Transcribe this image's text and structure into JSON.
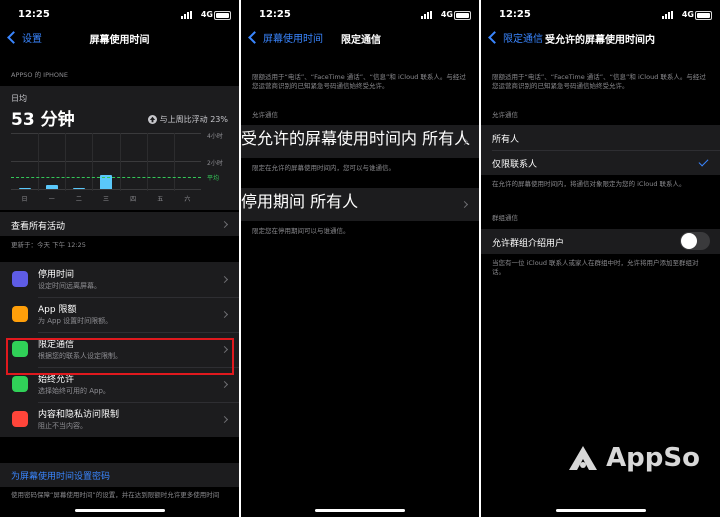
{
  "status": {
    "time": "12:25",
    "network": "4G"
  },
  "s1": {
    "back": "设置",
    "title": "屏幕使用时间",
    "device": "APPSO 的 IPHONE",
    "avg_label": "日均",
    "avg_value": "53 分钟",
    "compare": "与上周比浮动 23%",
    "chart_data": {
      "type": "bar",
      "categories": [
        "日",
        "一",
        "二",
        "三",
        "四",
        "五",
        "六"
      ],
      "values": [
        3,
        18,
        6,
        62,
        0,
        0,
        0
      ],
      "ylabels": [
        "4小时",
        "2小时"
      ],
      "avg_label": "平均",
      "avg_value": 53,
      "ylim": [
        0,
        240
      ]
    },
    "see_all": "查看所有活动",
    "updated": "更新于：今天 下午 12:25",
    "items": [
      {
        "title": "停用时间",
        "sub": "设定时间远离屏幕。",
        "color": "#5e5ce6"
      },
      {
        "title": "App 限额",
        "sub": "为 App 设置时间限额。",
        "color": "#ff9f0a"
      },
      {
        "title": "限定通信",
        "sub": "根据您的联系人设定限制。",
        "color": "#30d158"
      },
      {
        "title": "始终允许",
        "sub": "选择始终可用的 App。",
        "color": "#30d158"
      },
      {
        "title": "内容和隐私访问限制",
        "sub": "阻止不当内容。",
        "color": "#ff453a"
      }
    ],
    "passcode": "为屏幕使用时间设置密码",
    "passcode_note": "使用密码保障“屏幕使用时间”的设置，并在达到限额时允许更多使用时间"
  },
  "s2": {
    "back": "屏幕使用时间",
    "title": "限定通信",
    "intro": "限额适用于“电话”、“FaceTime 通话”、“信息”和 iCloud 联系人。与经过您运营商识别的已知紧急号码通信始终受允许。",
    "sect": "允许通信",
    "row1_title": "受允许的屏幕使用时间内",
    "row1_sub": "所有人",
    "row1_note": "限定在允许的屏幕使用时间内，您可以与谁通信。",
    "row2_title": "停用期间",
    "row2_sub": "所有人",
    "row2_note": "限定您在停用期间可以与谁通信。"
  },
  "s3": {
    "back": "限定通信",
    "title": "受允许的屏幕使用时间内",
    "intro": "限额适用于“电话”、“FaceTime 通话”、“信息”和 iCloud 联系人。与经过您运营商识别的已知紧急号码通信始终受允许。",
    "sect": "允许通信",
    "opt1": "所有人",
    "opt2": "仅限联系人",
    "opt_note": "在允许的屏幕使用时间内，将通信对象限定为您的 iCloud 联系人。",
    "group_sect": "群组通信",
    "toggle_label": "允许群组介绍用户",
    "toggle_note": "当您有一位 iCloud 联系人或家人在群组中时，允许将用户添加至群组对话。"
  },
  "watermark": "AppSo"
}
